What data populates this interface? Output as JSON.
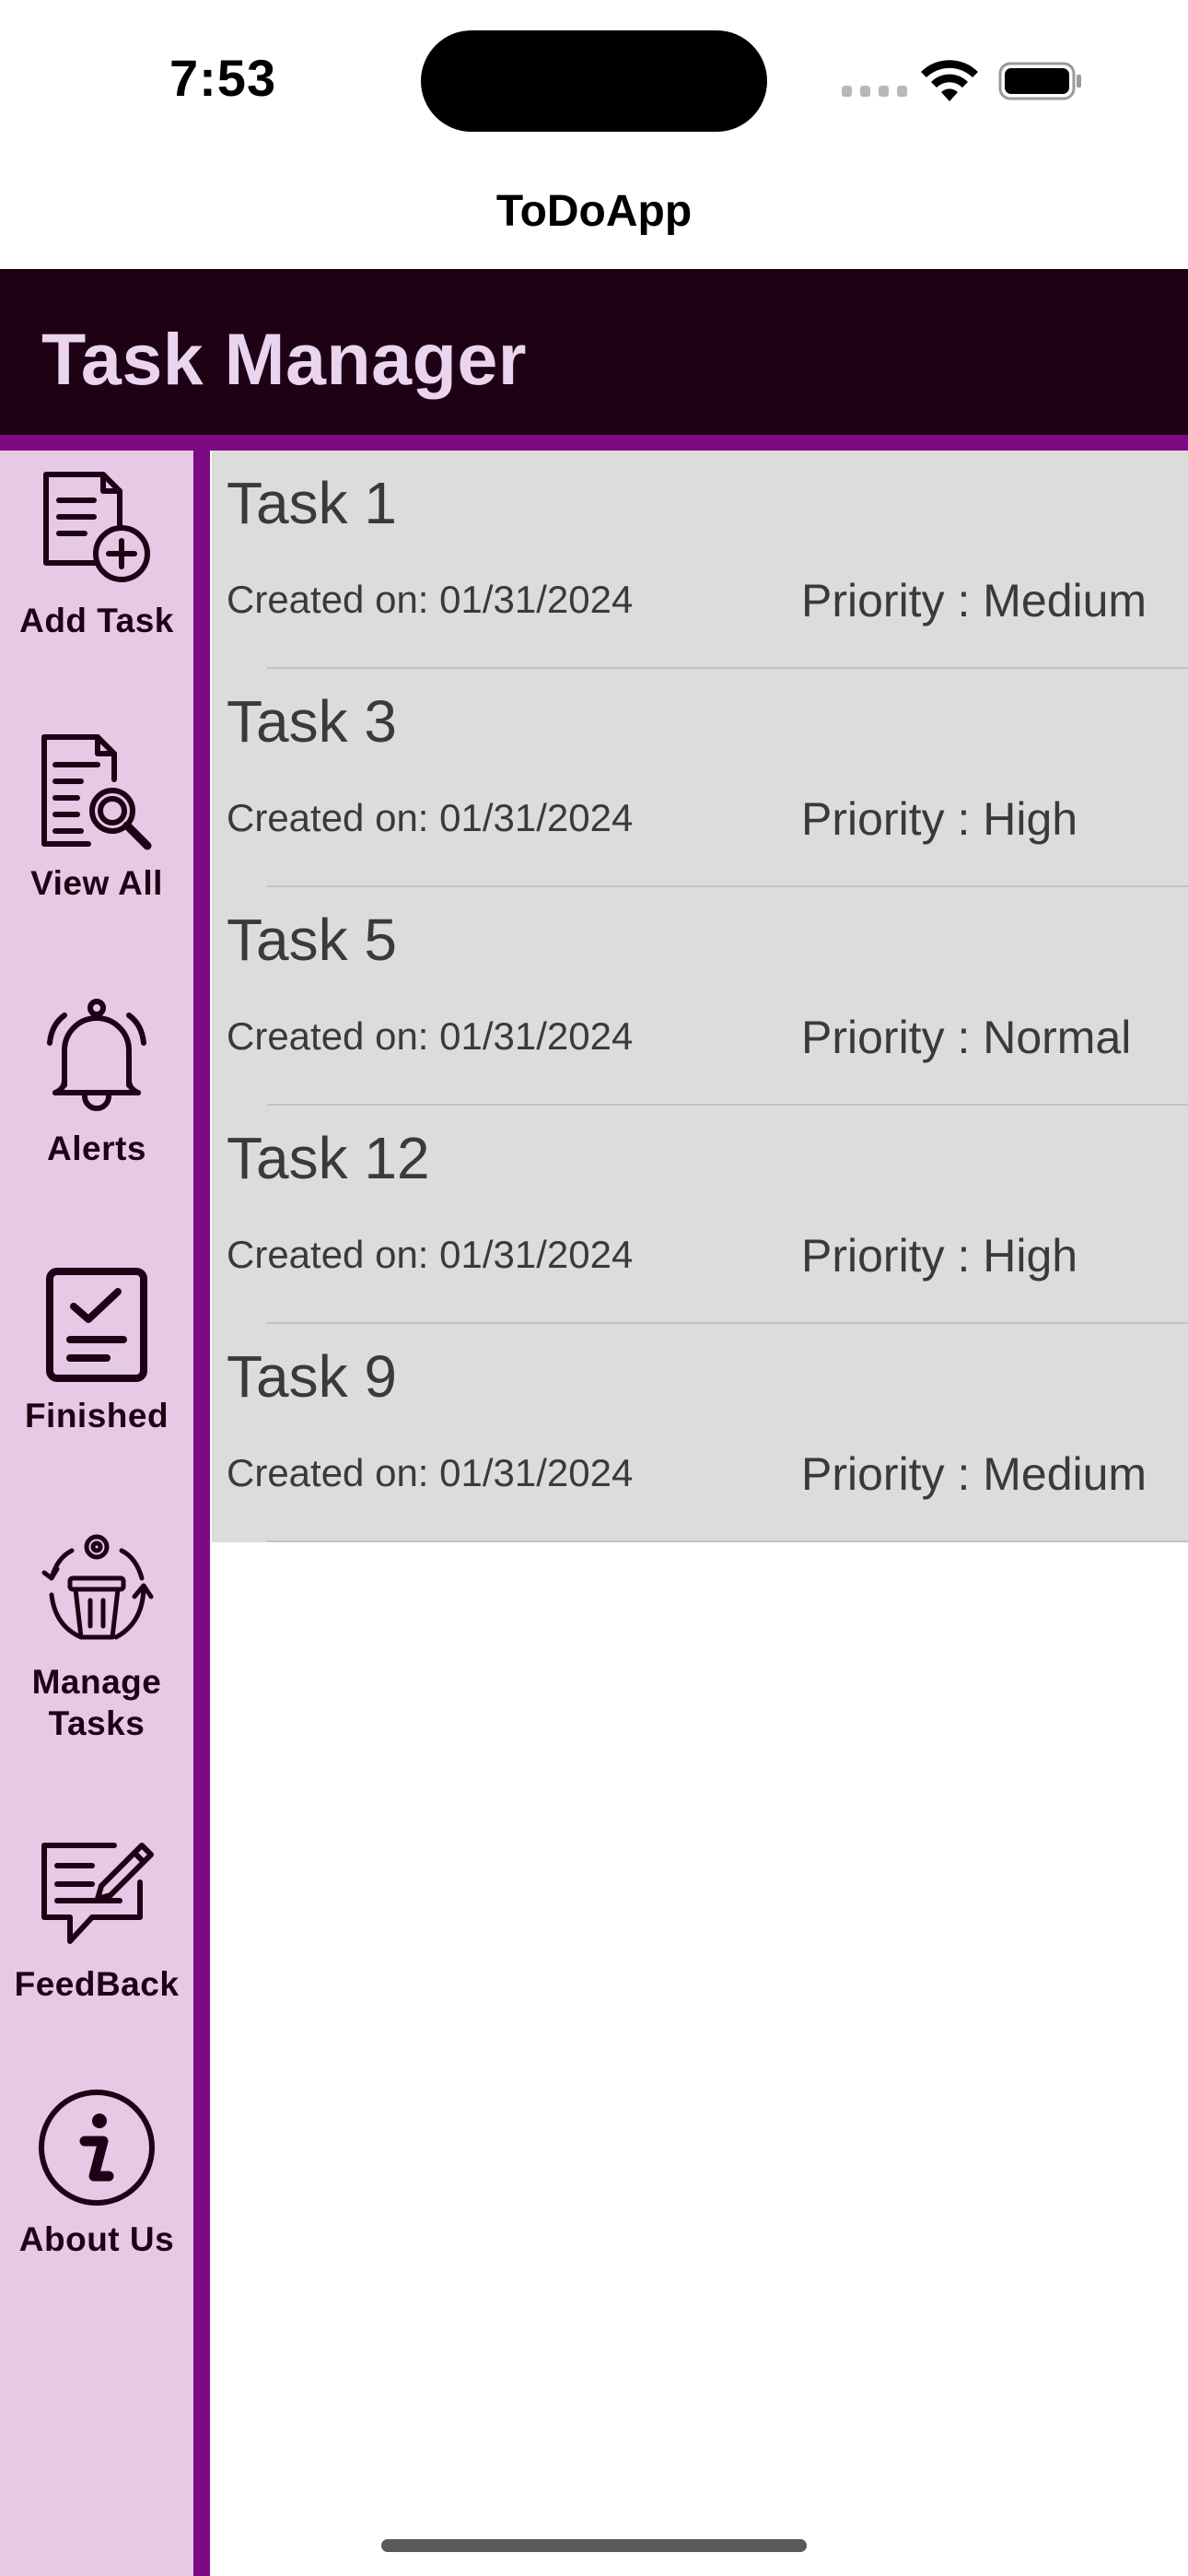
{
  "status_bar": {
    "time": "7:53"
  },
  "app": {
    "title": "ToDoApp"
  },
  "header": {
    "title": "Task Manager"
  },
  "sidebar": {
    "items": [
      {
        "label": "Add Task",
        "icon": "add-document-icon"
      },
      {
        "label": "View All",
        "icon": "search-document-icon"
      },
      {
        "label": "Alerts",
        "icon": "bell-icon"
      },
      {
        "label": "Finished",
        "icon": "checklist-icon"
      },
      {
        "label": "Manage Tasks",
        "icon": "trash-cycle-icon"
      },
      {
        "label": "FeedBack",
        "icon": "feedback-icon"
      },
      {
        "label": "About Us",
        "icon": "info-icon"
      }
    ]
  },
  "tasks": [
    {
      "title": "Task 1",
      "created": "Created on: 01/31/2024",
      "priority": "Priority : Medium"
    },
    {
      "title": "Task 3",
      "created": "Created on: 01/31/2024",
      "priority": "Priority : High"
    },
    {
      "title": "Task 5",
      "created": "Created on: 01/31/2024",
      "priority": "Priority : Normal"
    },
    {
      "title": "Task 12",
      "created": "Created on: 01/31/2024",
      "priority": "Priority : High"
    },
    {
      "title": "Task 9",
      "created": "Created on: 01/31/2024",
      "priority": "Priority : Medium"
    }
  ],
  "colors": {
    "header_bg": "#1f0116",
    "header_text": "#ead5ee",
    "accent_purple": "#7d0a82",
    "sidebar_bg": "#e5c9e5",
    "row_bg": "#dcdcdc"
  }
}
